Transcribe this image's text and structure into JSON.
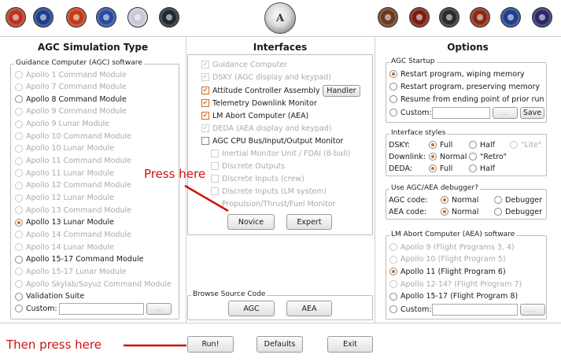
{
  "patches": {
    "left": [
      "#b8341f",
      "#1e3f8a",
      "#c23a1a",
      "#2a4aa0",
      "#c8c8d8",
      "#222831"
    ],
    "right": [
      "#6b3a1e",
      "#7a1e10",
      "#2b2b2b",
      "#8a2a12",
      "#1f3d8f",
      "#2a2a6a"
    ],
    "center_text": "A"
  },
  "left_panel": {
    "title": "AGC Simulation Type",
    "group_label": "Guidance Computer (AGC) software",
    "items": [
      {
        "label": "Apollo 1 Command Module",
        "enabled": false,
        "selected": false
      },
      {
        "label": "Apollo 7 Command Module",
        "enabled": false,
        "selected": false
      },
      {
        "label": "Apollo 8 Command Module",
        "enabled": true,
        "selected": false
      },
      {
        "label": "Apollo 9 Command Module",
        "enabled": false,
        "selected": false
      },
      {
        "label": "Apollo 9 Lunar Module",
        "enabled": false,
        "selected": false
      },
      {
        "label": "Apollo 10 Command Module",
        "enabled": false,
        "selected": false
      },
      {
        "label": "Apollo 10 Lunar Module",
        "enabled": false,
        "selected": false
      },
      {
        "label": "Apollo 11 Command Module",
        "enabled": false,
        "selected": false
      },
      {
        "label": "Apollo 11 Lunar Module",
        "enabled": false,
        "selected": false
      },
      {
        "label": "Apollo 12 Command Module",
        "enabled": false,
        "selected": false
      },
      {
        "label": "Apollo 12 Lunar Module",
        "enabled": false,
        "selected": false
      },
      {
        "label": "Apollo 13 Command Module",
        "enabled": false,
        "selected": false
      },
      {
        "label": "Apollo 13 Lunar Module",
        "enabled": true,
        "selected": true
      },
      {
        "label": "Apollo 14 Command Module",
        "enabled": false,
        "selected": false
      },
      {
        "label": "Apollo 14 Lunar Module",
        "enabled": false,
        "selected": false
      },
      {
        "label": "Apollo 15-17 Command Module",
        "enabled": true,
        "selected": false
      },
      {
        "label": "Apollo 15-17 Lunar Module",
        "enabled": false,
        "selected": false
      },
      {
        "label": "Apollo Skylab/Soyuz Command Module",
        "enabled": false,
        "selected": false
      },
      {
        "label": "Validation Suite",
        "enabled": true,
        "selected": false
      }
    ],
    "custom_label": "Custom:",
    "custom_value": "",
    "browse_label": "..."
  },
  "interfaces": {
    "title": "Interfaces",
    "items": [
      {
        "label": "Guidance Computer",
        "enabled": false,
        "checked": true
      },
      {
        "label": "DSKY (AGC display and keypad)",
        "enabled": false,
        "checked": true
      },
      {
        "label": "Attitude Controller Assembly",
        "enabled": true,
        "checked": true
      },
      {
        "label": "Telemetry Downlink Monitor",
        "enabled": true,
        "checked": true
      },
      {
        "label": "LM Abort Computer (AEA)",
        "enabled": true,
        "checked": true
      },
      {
        "label": "DEDA (AEA display and keypad)",
        "enabled": false,
        "checked": true
      },
      {
        "label": "AGC CPU Bus/Input/Output Monitor",
        "enabled": true,
        "checked": false
      }
    ],
    "handler_label": "Handler",
    "sub_items": [
      {
        "label": "Inertial Monitor Unit / FDAI (8-ball)",
        "checkbox": true
      },
      {
        "label": "Discrete Outputs",
        "checkbox": true
      },
      {
        "label": "Discrete Inputs (crew)",
        "checkbox": true
      },
      {
        "label": "Discrete Inputs (LM system)",
        "checkbox": true
      },
      {
        "label": "Propulsion/Thrust/Fuel Monitor",
        "checkbox": false
      }
    ],
    "novice_label": "Novice",
    "expert_label": "Expert",
    "browse_group_label": "Browse Source Code",
    "agc_label": "AGC",
    "aea_label": "AEA"
  },
  "options": {
    "title": "Options",
    "startup": {
      "group_label": "AGC Startup",
      "items": [
        {
          "label": "Restart program, wiping memory",
          "selected": true
        },
        {
          "label": "Restart program, preserving memory",
          "selected": false
        },
        {
          "label": "Resume from ending point of prior run",
          "selected": false
        }
      ],
      "custom_label": "Custom:",
      "browse_label": "...",
      "save_label": "Save"
    },
    "styles": {
      "group_label": "Interface styles",
      "rows": [
        {
          "name": "DSKY:",
          "opts": [
            {
              "label": "Full",
              "selected": true,
              "enabled": true
            },
            {
              "label": "Half",
              "selected": false,
              "enabled": true
            },
            {
              "label": "\"Lite\"",
              "selected": false,
              "enabled": false
            }
          ]
        },
        {
          "name": "Downlink:",
          "opts": [
            {
              "label": "Normal",
              "selected": true,
              "enabled": true
            },
            {
              "label": "\"Retro\"",
              "selected": false,
              "enabled": true
            }
          ]
        },
        {
          "name": "DEDA:",
          "opts": [
            {
              "label": "Full",
              "selected": true,
              "enabled": true
            },
            {
              "label": "Half",
              "selected": false,
              "enabled": true
            }
          ]
        }
      ]
    },
    "debugger": {
      "group_label": "Use AGC/AEA debugger?",
      "rows": [
        {
          "name": "AGC code:",
          "normal": "Normal",
          "debugger": "Debugger"
        },
        {
          "name": "AEA code:",
          "normal": "Normal",
          "debugger": "Debugger"
        }
      ]
    },
    "aea": {
      "group_label": "LM Abort Computer (AEA) software",
      "items": [
        {
          "label": "Apollo 9 (Flight Programs 3, 4)",
          "enabled": false,
          "selected": false
        },
        {
          "label": "Apollo 10 (Flight Program 5)",
          "enabled": false,
          "selected": false
        },
        {
          "label": "Apollo 11 (Flight Program 6)",
          "enabled": true,
          "selected": true
        },
        {
          "label": "Apollo 12-14? (Flight Program 7)",
          "enabled": false,
          "selected": false
        },
        {
          "label": "Apollo 15-17 (Flight Program 8)",
          "enabled": true,
          "selected": false
        }
      ],
      "custom_label": "Custom:",
      "browse_label": "..."
    }
  },
  "bottom": {
    "run_label": "Run!",
    "defaults_label": "Defaults",
    "exit_label": "Exit"
  },
  "annotations": {
    "press_here": "Press here",
    "then_press_here": "Then press here",
    "color": "#d01010"
  }
}
